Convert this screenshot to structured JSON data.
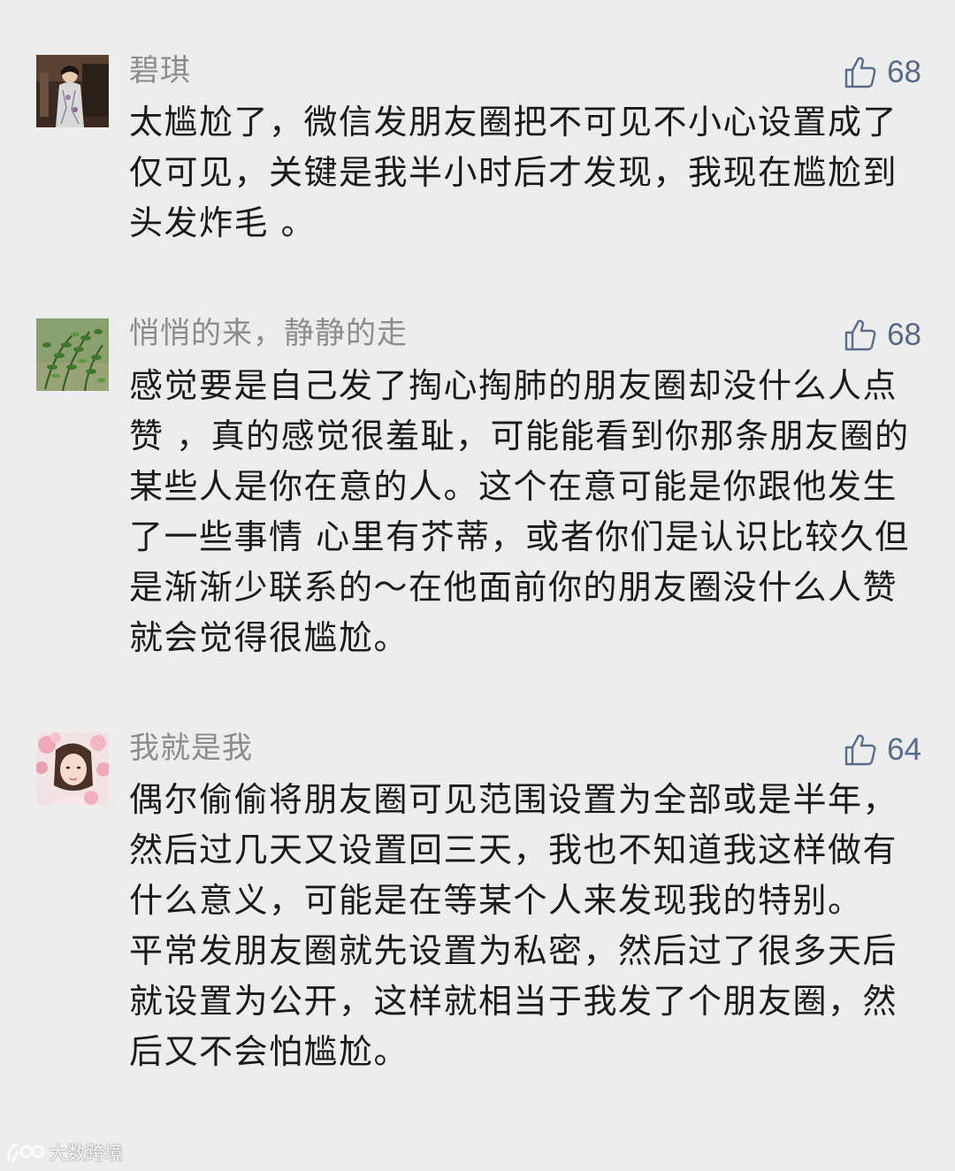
{
  "comments": [
    {
      "username": "碧琪",
      "likes": "68",
      "avatar": "avatar-woman-qipao",
      "paragraphs": [
        "太尴尬了，微信发朋友圈把不可见不小心设置成了仅可见，关键是我半小时后才发现，我现在尴尬到头发炸毛 。"
      ]
    },
    {
      "username": "悄悄的来，静静的走",
      "likes": "68",
      "avatar": "avatar-green-plant",
      "paragraphs": [
        "感觉要是自己发了掏心掏肺的朋友圈却没什么人点赞 ，真的感觉很羞耻，可能能看到你那条朋友圈的某些人是你在意的人。这个在意可能是你跟他发生了一些事情 心里有芥蒂，或者你们是认识比较久但是渐渐少联系的～在他面前你的朋友圈没什么人赞就会觉得很尴尬。"
      ]
    },
    {
      "username": "我就是我",
      "likes": "64",
      "avatar": "avatar-girl-flowers",
      "paragraphs": [
        "偶尔偷偷将朋友圈可见范围设置为全部或是半年，然后过几天又设置回三天，我也不知道我这样做有什么意义，可能是在等某个人来发现我的特别。",
        "平常发朋友圈就先设置为私密，然后过了很多天后就设置为公开，这样就相当于我发了个朋友圈，然后又不会怕尴尬。"
      ]
    }
  ],
  "watermark": {
    "text": "大数跨境"
  },
  "colors": {
    "background": "#ededed",
    "username": "#8c8c8c",
    "like": "#5b6b8c",
    "text": "#1a1a1a"
  }
}
